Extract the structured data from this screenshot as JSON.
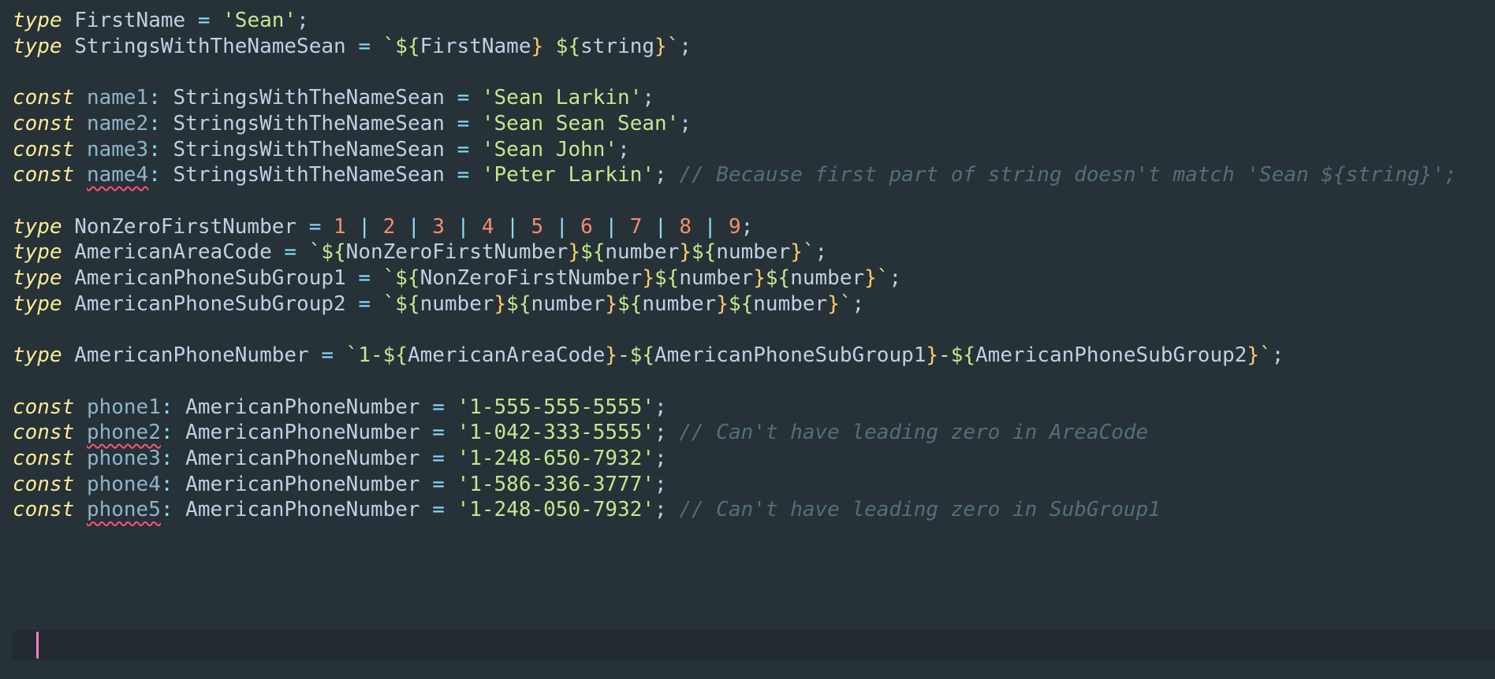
{
  "lines": [
    {
      "parts": [
        {
          "t": "type",
          "c": "kw"
        },
        {
          "t": " "
        },
        {
          "t": "FirstName",
          "c": "ty"
        },
        {
          "t": " "
        },
        {
          "t": "=",
          "c": "op"
        },
        {
          "t": " "
        },
        {
          "t": "'Sean'",
          "c": "st"
        },
        {
          "t": ";",
          "c": "pn"
        }
      ]
    },
    {
      "parts": [
        {
          "t": "type",
          "c": "kw"
        },
        {
          "t": " "
        },
        {
          "t": "StringsWithTheNameSean",
          "c": "ty"
        },
        {
          "t": " "
        },
        {
          "t": "=",
          "c": "op"
        },
        {
          "t": " "
        },
        {
          "t": "`${",
          "c": "st"
        },
        {
          "t": "",
          "c": "br"
        },
        {
          "t": "FirstName",
          "c": "ty"
        },
        {
          "t": "}",
          "c": "br"
        },
        {
          "t": " ${",
          "c": "st"
        },
        {
          "t": "string",
          "c": "ty"
        },
        {
          "t": "}",
          "c": "br"
        },
        {
          "t": "`",
          "c": "st"
        },
        {
          "t": ";",
          "c": "pn"
        }
      ]
    },
    {
      "parts": []
    },
    {
      "parts": [
        {
          "t": "const",
          "c": "kw"
        },
        {
          "t": " "
        },
        {
          "t": "name1",
          "c": "vr name"
        },
        {
          "t": ": ",
          "c": "op"
        },
        {
          "t": "StringsWithTheNameSean",
          "c": "ty"
        },
        {
          "t": " "
        },
        {
          "t": "=",
          "c": "op"
        },
        {
          "t": " "
        },
        {
          "t": "'Sean Larkin'",
          "c": "st"
        },
        {
          "t": ";",
          "c": "pn"
        }
      ]
    },
    {
      "parts": [
        {
          "t": "const",
          "c": "kw"
        },
        {
          "t": " "
        },
        {
          "t": "name2",
          "c": "vr name"
        },
        {
          "t": ": ",
          "c": "op"
        },
        {
          "t": "StringsWithTheNameSean",
          "c": "ty"
        },
        {
          "t": " "
        },
        {
          "t": "=",
          "c": "op"
        },
        {
          "t": " "
        },
        {
          "t": "'Sean Sean Sean'",
          "c": "st"
        },
        {
          "t": ";",
          "c": "pn"
        }
      ]
    },
    {
      "parts": [
        {
          "t": "const",
          "c": "kw"
        },
        {
          "t": " "
        },
        {
          "t": "name3",
          "c": "vr name"
        },
        {
          "t": ": ",
          "c": "op"
        },
        {
          "t": "StringsWithTheNameSean",
          "c": "ty"
        },
        {
          "t": " "
        },
        {
          "t": "=",
          "c": "op"
        },
        {
          "t": " "
        },
        {
          "t": "'Sean John'",
          "c": "st"
        },
        {
          "t": ";",
          "c": "pn"
        }
      ]
    },
    {
      "parts": [
        {
          "t": "const",
          "c": "kw"
        },
        {
          "t": " "
        },
        {
          "t": "name4",
          "c": "vr name err"
        },
        {
          "t": ": ",
          "c": "op"
        },
        {
          "t": "StringsWithTheNameSean",
          "c": "ty"
        },
        {
          "t": " "
        },
        {
          "t": "=",
          "c": "op"
        },
        {
          "t": " "
        },
        {
          "t": "'Peter Larkin'",
          "c": "st"
        },
        {
          "t": ";",
          "c": "pn"
        },
        {
          "t": " "
        },
        {
          "t": "// Because first part of string doesn't match 'Sean ${string}';",
          "c": "cm"
        }
      ]
    },
    {
      "parts": []
    },
    {
      "parts": [
        {
          "t": "type",
          "c": "kw"
        },
        {
          "t": " "
        },
        {
          "t": "NonZeroFirstNumber",
          "c": "ty"
        },
        {
          "t": " "
        },
        {
          "t": "=",
          "c": "op"
        },
        {
          "t": " "
        },
        {
          "t": "1",
          "c": "nm"
        },
        {
          "t": " | ",
          "c": "op"
        },
        {
          "t": "2",
          "c": "nm"
        },
        {
          "t": " | ",
          "c": "op"
        },
        {
          "t": "3",
          "c": "nm"
        },
        {
          "t": " | ",
          "c": "op"
        },
        {
          "t": "4",
          "c": "nm"
        },
        {
          "t": " | ",
          "c": "op"
        },
        {
          "t": "5",
          "c": "nm"
        },
        {
          "t": " | ",
          "c": "op"
        },
        {
          "t": "6",
          "c": "nm"
        },
        {
          "t": " | ",
          "c": "op"
        },
        {
          "t": "7",
          "c": "nm"
        },
        {
          "t": " | ",
          "c": "op"
        },
        {
          "t": "8",
          "c": "nm"
        },
        {
          "t": " | ",
          "c": "op"
        },
        {
          "t": "9",
          "c": "nm"
        },
        {
          "t": ";",
          "c": "pn"
        }
      ]
    },
    {
      "parts": [
        {
          "t": "type",
          "c": "kw"
        },
        {
          "t": " "
        },
        {
          "t": "AmericanAreaCode",
          "c": "ty"
        },
        {
          "t": " "
        },
        {
          "t": "=",
          "c": "op"
        },
        {
          "t": " "
        },
        {
          "t": "`${",
          "c": "st"
        },
        {
          "t": "NonZeroFirstNumber",
          "c": "ty"
        },
        {
          "t": "}",
          "c": "br"
        },
        {
          "t": "${",
          "c": "st"
        },
        {
          "t": "number",
          "c": "ty"
        },
        {
          "t": "}",
          "c": "br"
        },
        {
          "t": "${",
          "c": "st"
        },
        {
          "t": "number",
          "c": "ty"
        },
        {
          "t": "}",
          "c": "br"
        },
        {
          "t": "`",
          "c": "st"
        },
        {
          "t": ";",
          "c": "pn"
        }
      ]
    },
    {
      "parts": [
        {
          "t": "type",
          "c": "kw"
        },
        {
          "t": " "
        },
        {
          "t": "AmericanPhoneSubGroup1",
          "c": "ty"
        },
        {
          "t": " "
        },
        {
          "t": "=",
          "c": "op"
        },
        {
          "t": " "
        },
        {
          "t": "`${",
          "c": "st"
        },
        {
          "t": "NonZeroFirstNumber",
          "c": "ty"
        },
        {
          "t": "}",
          "c": "br"
        },
        {
          "t": "${",
          "c": "st"
        },
        {
          "t": "number",
          "c": "ty"
        },
        {
          "t": "}",
          "c": "br"
        },
        {
          "t": "${",
          "c": "st"
        },
        {
          "t": "number",
          "c": "ty"
        },
        {
          "t": "}",
          "c": "br"
        },
        {
          "t": "`",
          "c": "st"
        },
        {
          "t": ";",
          "c": "pn"
        }
      ]
    },
    {
      "parts": [
        {
          "t": "type",
          "c": "kw"
        },
        {
          "t": " "
        },
        {
          "t": "AmericanPhoneSubGroup2",
          "c": "ty"
        },
        {
          "t": " "
        },
        {
          "t": "=",
          "c": "op"
        },
        {
          "t": " "
        },
        {
          "t": "`${",
          "c": "st"
        },
        {
          "t": "number",
          "c": "ty"
        },
        {
          "t": "}",
          "c": "br"
        },
        {
          "t": "${",
          "c": "st"
        },
        {
          "t": "number",
          "c": "ty"
        },
        {
          "t": "}",
          "c": "br"
        },
        {
          "t": "${",
          "c": "st"
        },
        {
          "t": "number",
          "c": "ty"
        },
        {
          "t": "}",
          "c": "br"
        },
        {
          "t": "${",
          "c": "st"
        },
        {
          "t": "number",
          "c": "ty"
        },
        {
          "t": "}",
          "c": "br"
        },
        {
          "t": "`",
          "c": "st"
        },
        {
          "t": ";",
          "c": "pn"
        }
      ]
    },
    {
      "parts": []
    },
    {
      "parts": [
        {
          "t": "type",
          "c": "kw"
        },
        {
          "t": " "
        },
        {
          "t": "AmericanPhoneNumber",
          "c": "ty"
        },
        {
          "t": " "
        },
        {
          "t": "=",
          "c": "op"
        },
        {
          "t": " "
        },
        {
          "t": "`1-${",
          "c": "st"
        },
        {
          "t": "AmericanAreaCode",
          "c": "ty"
        },
        {
          "t": "}",
          "c": "br"
        },
        {
          "t": "-${",
          "c": "st"
        },
        {
          "t": "AmericanPhoneSubGroup1",
          "c": "ty"
        },
        {
          "t": "}",
          "c": "br"
        },
        {
          "t": "-${",
          "c": "st"
        },
        {
          "t": "AmericanPhoneSubGroup2",
          "c": "ty"
        },
        {
          "t": "}",
          "c": "br"
        },
        {
          "t": "`",
          "c": "st"
        },
        {
          "t": ";",
          "c": "pn"
        }
      ]
    },
    {
      "parts": []
    },
    {
      "parts": [
        {
          "t": "const",
          "c": "kw"
        },
        {
          "t": " "
        },
        {
          "t": "phone1",
          "c": "vr name"
        },
        {
          "t": ": ",
          "c": "op"
        },
        {
          "t": "AmericanPhoneNumber",
          "c": "ty"
        },
        {
          "t": " "
        },
        {
          "t": "=",
          "c": "op"
        },
        {
          "t": " "
        },
        {
          "t": "'1-555-555-5555'",
          "c": "st"
        },
        {
          "t": ";",
          "c": "pn"
        }
      ]
    },
    {
      "parts": [
        {
          "t": "const",
          "c": "kw"
        },
        {
          "t": " "
        },
        {
          "t": "phone2",
          "c": "vr name err"
        },
        {
          "t": ": ",
          "c": "op"
        },
        {
          "t": "AmericanPhoneNumber",
          "c": "ty"
        },
        {
          "t": " "
        },
        {
          "t": "=",
          "c": "op"
        },
        {
          "t": " "
        },
        {
          "t": "'1-042-333-5555'",
          "c": "st"
        },
        {
          "t": ";",
          "c": "pn"
        },
        {
          "t": " "
        },
        {
          "t": "// Can't have leading zero in AreaCode",
          "c": "cm"
        }
      ]
    },
    {
      "parts": [
        {
          "t": "const",
          "c": "kw"
        },
        {
          "t": " "
        },
        {
          "t": "phone3",
          "c": "vr name"
        },
        {
          "t": ": ",
          "c": "op"
        },
        {
          "t": "AmericanPhoneNumber",
          "c": "ty"
        },
        {
          "t": " "
        },
        {
          "t": "=",
          "c": "op"
        },
        {
          "t": " "
        },
        {
          "t": "'1-248-650-7932'",
          "c": "st"
        },
        {
          "t": ";",
          "c": "pn"
        }
      ]
    },
    {
      "parts": [
        {
          "t": "const",
          "c": "kw"
        },
        {
          "t": " "
        },
        {
          "t": "phone4",
          "c": "vr name"
        },
        {
          "t": ": ",
          "c": "op"
        },
        {
          "t": "AmericanPhoneNumber",
          "c": "ty"
        },
        {
          "t": " "
        },
        {
          "t": "=",
          "c": "op"
        },
        {
          "t": " "
        },
        {
          "t": "'1-586-336-3777'",
          "c": "st"
        },
        {
          "t": ";",
          "c": "pn"
        }
      ]
    },
    {
      "parts": [
        {
          "t": "const",
          "c": "kw"
        },
        {
          "t": " "
        },
        {
          "t": "phone5",
          "c": "vr name err"
        },
        {
          "t": ": ",
          "c": "op"
        },
        {
          "t": "AmericanPhoneNumber",
          "c": "ty"
        },
        {
          "t": " "
        },
        {
          "t": "=",
          "c": "op"
        },
        {
          "t": " "
        },
        {
          "t": "'1-248-050-7932'",
          "c": "st"
        },
        {
          "t": ";",
          "c": "pn"
        },
        {
          "t": " "
        },
        {
          "t": "// Can't have leading zero in SubGroup1",
          "c": "cm"
        }
      ]
    }
  ]
}
